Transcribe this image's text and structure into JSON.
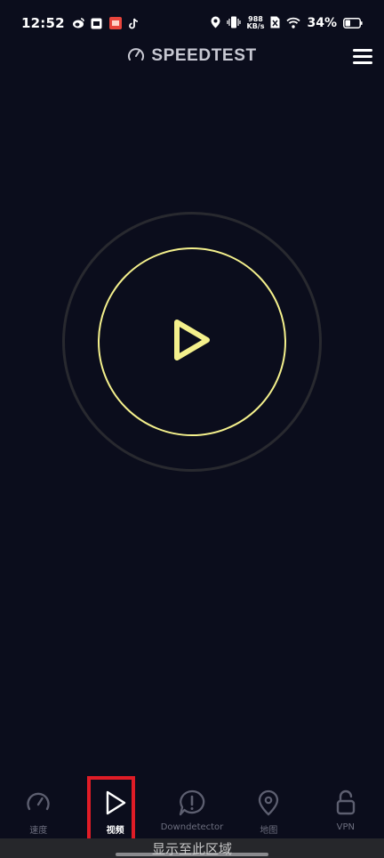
{
  "status_bar": {
    "time": "12:52",
    "net_speed_value": "988",
    "net_speed_unit": "KB/s",
    "battery_percent": "34%",
    "icons_left": [
      "weibo-icon",
      "store-icon",
      "red-app-icon",
      "tiktok-icon"
    ],
    "icons_right": [
      "location-icon",
      "vibrate-icon",
      "sim-icon",
      "wifi-icon",
      "battery-icon"
    ]
  },
  "header": {
    "title": "SPEEDTEST",
    "menu_icon": "hamburger-icon"
  },
  "play": {
    "icon": "play-icon",
    "ring_color": "#f4f08c"
  },
  "bottom_nav": {
    "items": [
      {
        "label": "速度",
        "icon": "speedometer-icon"
      },
      {
        "label": "视频",
        "icon": "play-icon",
        "active": true
      },
      {
        "label": "Downdetector",
        "icon": "alert-bubble-icon"
      },
      {
        "label": "地图",
        "icon": "map-pin-icon"
      },
      {
        "label": "VPN",
        "icon": "unlock-icon"
      }
    ]
  },
  "bottom_hint": {
    "text": "显示至此区域"
  },
  "colors": {
    "background": "#0b0d1c",
    "accent": "#f4f08c",
    "highlight": "#e01c26"
  }
}
